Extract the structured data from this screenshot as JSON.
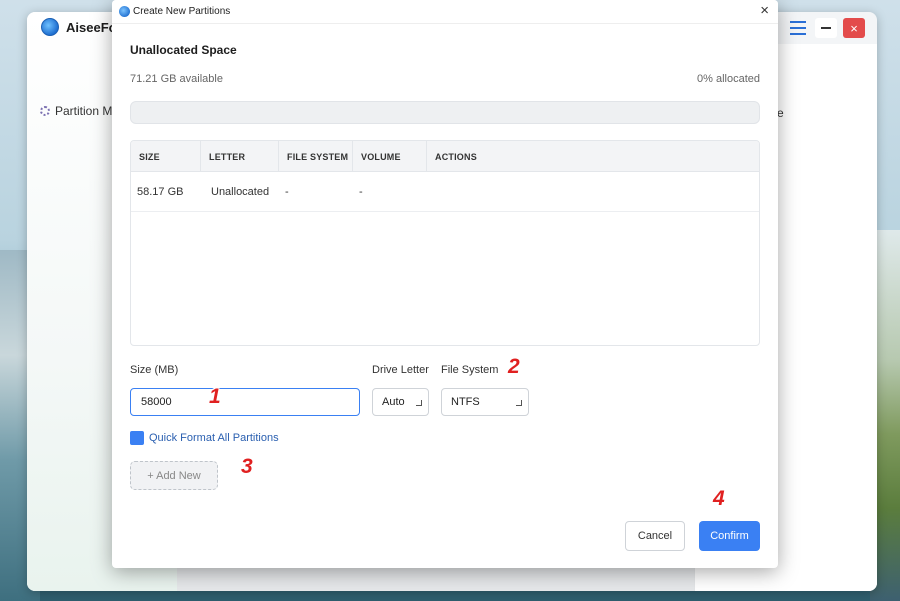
{
  "app": {
    "title": "AiseeFox",
    "nav_item": "Partition Ma",
    "right_text": "e",
    "close_glyph": "×"
  },
  "dialog": {
    "title": "Create New Partitions",
    "close_glyph": "×",
    "section_title": "Unallocated Space",
    "available": "71.21 GB available",
    "allocated": "0% allocated",
    "allocated_fraction": 0
  },
  "table": {
    "headers": [
      "SIZE",
      "LETTER",
      "FILE SYSTEM",
      "VOLUME",
      "ACTIONS"
    ],
    "rows": [
      [
        "58.17 GB",
        "Unallocated",
        "-",
        "-",
        ""
      ]
    ]
  },
  "form": {
    "size_label": "Size (MB)",
    "size_value": "58000",
    "drive_letter_label": "Drive Letter",
    "drive_letter_value": "Auto",
    "file_system_label": "File System",
    "file_system_value": "NTFS",
    "quick_format_label": "Quick Format All Partitions",
    "add_new_label": "+ Add New"
  },
  "buttons": {
    "cancel": "Cancel",
    "confirm": "Confirm"
  },
  "steps": [
    "1",
    "2",
    "3",
    "4"
  ],
  "colors": {
    "accent": "#3a80f3",
    "step_marker": "#e02020",
    "close_button": "#e34b4b"
  }
}
